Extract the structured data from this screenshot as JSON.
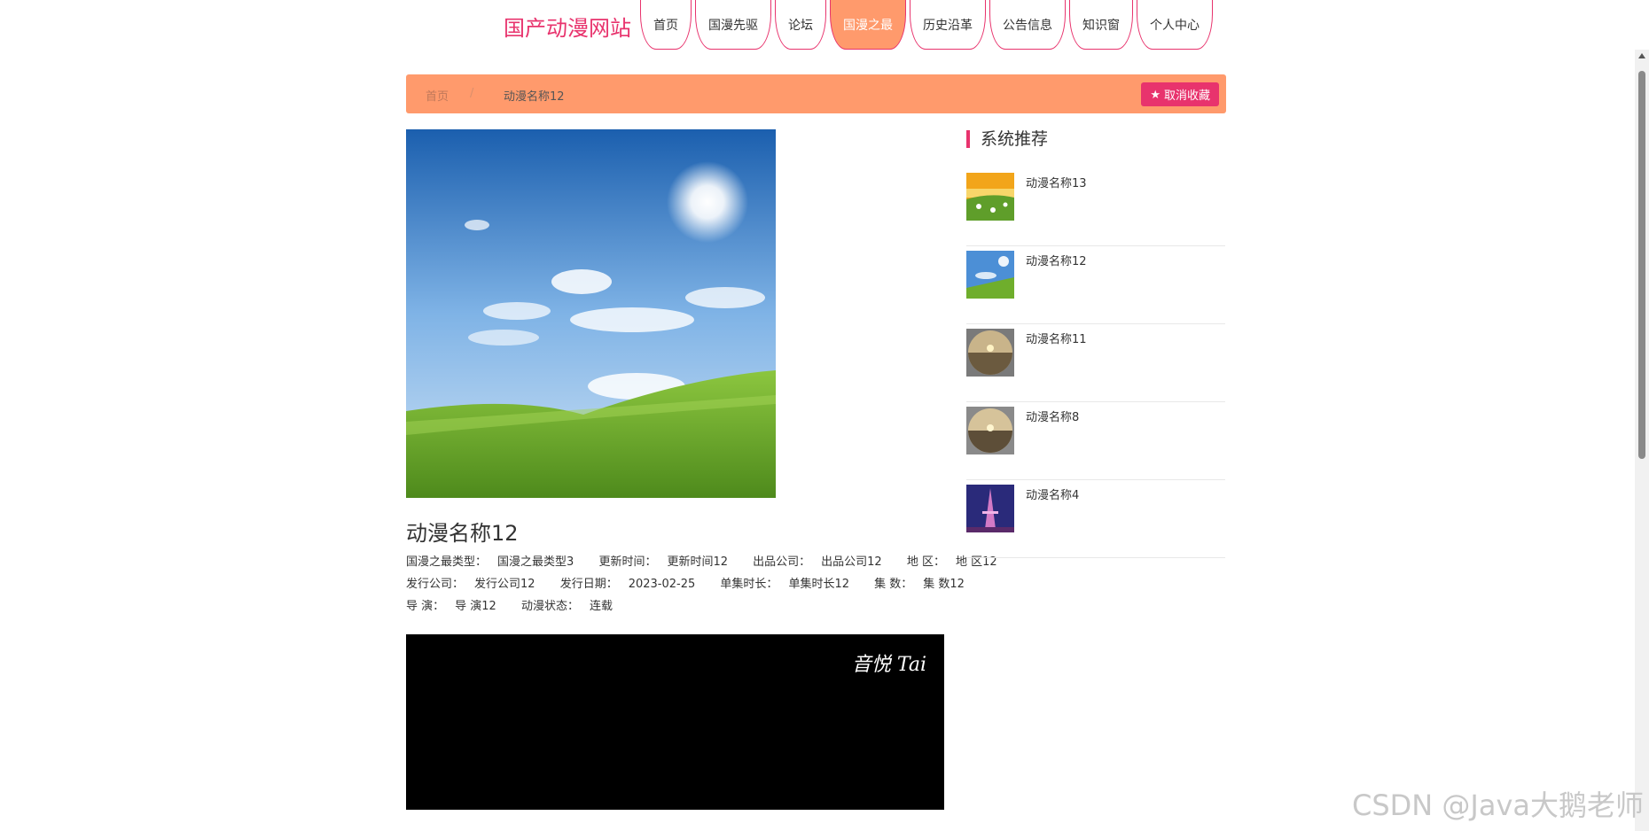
{
  "header": {
    "site_title": "国产动漫网站",
    "nav": [
      "首页",
      "国漫先驱",
      "论坛",
      "国漫之最",
      "历史沿革",
      "公告信息",
      "知识窗",
      "个人中心"
    ]
  },
  "breadcrumb": {
    "home": "首页",
    "sep": "/",
    "current": "动漫名称12",
    "fav_label": "取消收藏",
    "fav_icon": "star-icon"
  },
  "detail": {
    "title": "动漫名称12",
    "type_label": "国漫之最类型：",
    "type_value": "国漫之最类型3",
    "update_label": "更新时间：",
    "update_value": "更新时间12",
    "company_label": "出品公司：",
    "company_value": "出品公司12",
    "region_label": "地 区：",
    "region_value": "地 区12",
    "publisher_label": "发行公司：",
    "publisher_value": "发行公司12",
    "date_label": "发行日期：",
    "date_value": "2023-02-25",
    "duration_label": "单集时长：",
    "duration_value": "单集时长12",
    "episodes_label": "集 数：",
    "episodes_value": "集 数12",
    "director_label": "导 演：",
    "director_value": "导 演12",
    "status_label": "动漫状态：",
    "status_value": "连载"
  },
  "video": {
    "watermark": "音悦 Tai"
  },
  "recommend": {
    "title": "系统推荐",
    "items": [
      {
        "name": "动漫名称13"
      },
      {
        "name": "动漫名称12"
      },
      {
        "name": "动漫名称11"
      },
      {
        "name": "动漫名称8"
      },
      {
        "name": "动漫名称4"
      }
    ]
  },
  "watermark": "CSDN @Java大鹅老师",
  "colors": {
    "accent": "#e8336d",
    "bar": "#ff9a6c"
  }
}
